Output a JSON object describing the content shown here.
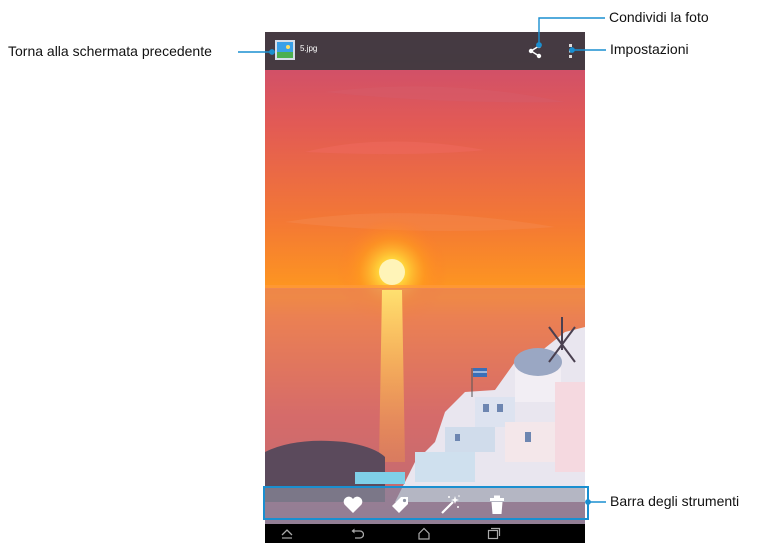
{
  "topbar": {
    "file_name": "5.jpg",
    "back_icon": "gallery-thumbnail-icon",
    "share_icon": "share-icon",
    "more_icon": "overflow-menu-icon"
  },
  "toolbar": {
    "items": [
      {
        "icon": "heart-icon"
      },
      {
        "icon": "tag-icon"
      },
      {
        "icon": "magic-wand-icon"
      },
      {
        "icon": "trash-icon"
      }
    ]
  },
  "navbar": {
    "items": [
      {
        "icon": "chevron-up-icon"
      },
      {
        "icon": "back-arrow-icon"
      },
      {
        "icon": "home-icon"
      },
      {
        "icon": "recent-apps-icon"
      }
    ]
  },
  "callouts": {
    "back": "Torna alla schermata precedente",
    "share": "Condividi la foto",
    "settings": "Impostazioni",
    "toolbar": "Barra degli strumenti"
  },
  "colors": {
    "accent": "#1a8fd0",
    "topbar": "#3a383e",
    "sun": "#ffd23a"
  }
}
